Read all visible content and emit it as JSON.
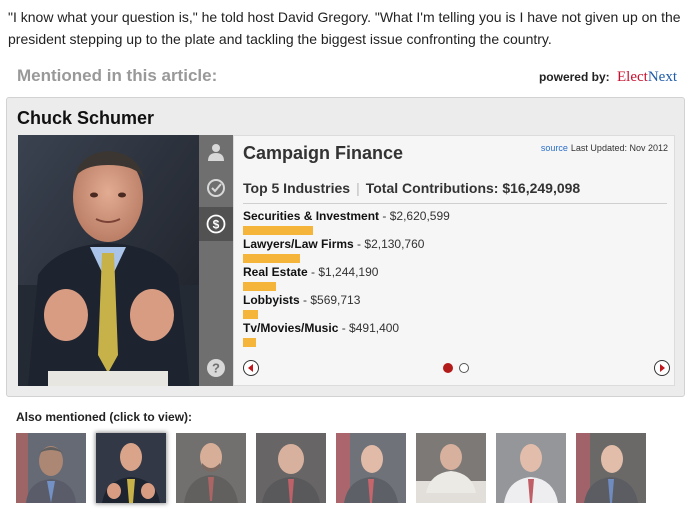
{
  "article": {
    "quote_text": "\"I know what your question is,\" he told host David Gregory. \"What I'm telling you is I have not given up on the president stepping up to the plate and tackling the biggest issue confronting the country."
  },
  "mentions": {
    "title": "Mentioned in this article:",
    "powered_by": "powered by:",
    "brand_part1": "Elect",
    "brand_part2": "Next"
  },
  "widget": {
    "politician_name": "Chuck Schumer",
    "icons": [
      "person-icon",
      "checkmark-icon",
      "dollar-icon",
      "help-icon"
    ],
    "panel_title": "Campaign Finance",
    "source_label": "source",
    "last_updated": "Last Updated: Nov 2012",
    "top_industries_label": "Top 5 Industries",
    "total_contributions_label": "Total Contributions: $16,249,098",
    "industries": [
      {
        "name": "Securities & Investment",
        "amount": "$2,620,599",
        "value": 2620599
      },
      {
        "name": "Lawyers/Law Firms",
        "amount": "$2,130,760",
        "value": 2130760
      },
      {
        "name": "Real Estate",
        "amount": "$1,244,190",
        "value": 1244190
      },
      {
        "name": "Lobbyists",
        "amount": "$569,713",
        "value": 569713
      },
      {
        "name": "Tv/Movies/Music",
        "amount": "$491,400",
        "value": 491400
      }
    ],
    "pager": {
      "pages": 2,
      "current": 1
    }
  },
  "also_mentioned": {
    "title": "Also mentioned (click to view):",
    "selected_index": 1,
    "thumbnails": 8
  },
  "colors": {
    "accent_bar": "#f5b53a",
    "active_dot": "#b31b1b",
    "brand_red": "#c8102e",
    "brand_blue": "#1f5ba8",
    "link_blue": "#2a6fc9"
  }
}
